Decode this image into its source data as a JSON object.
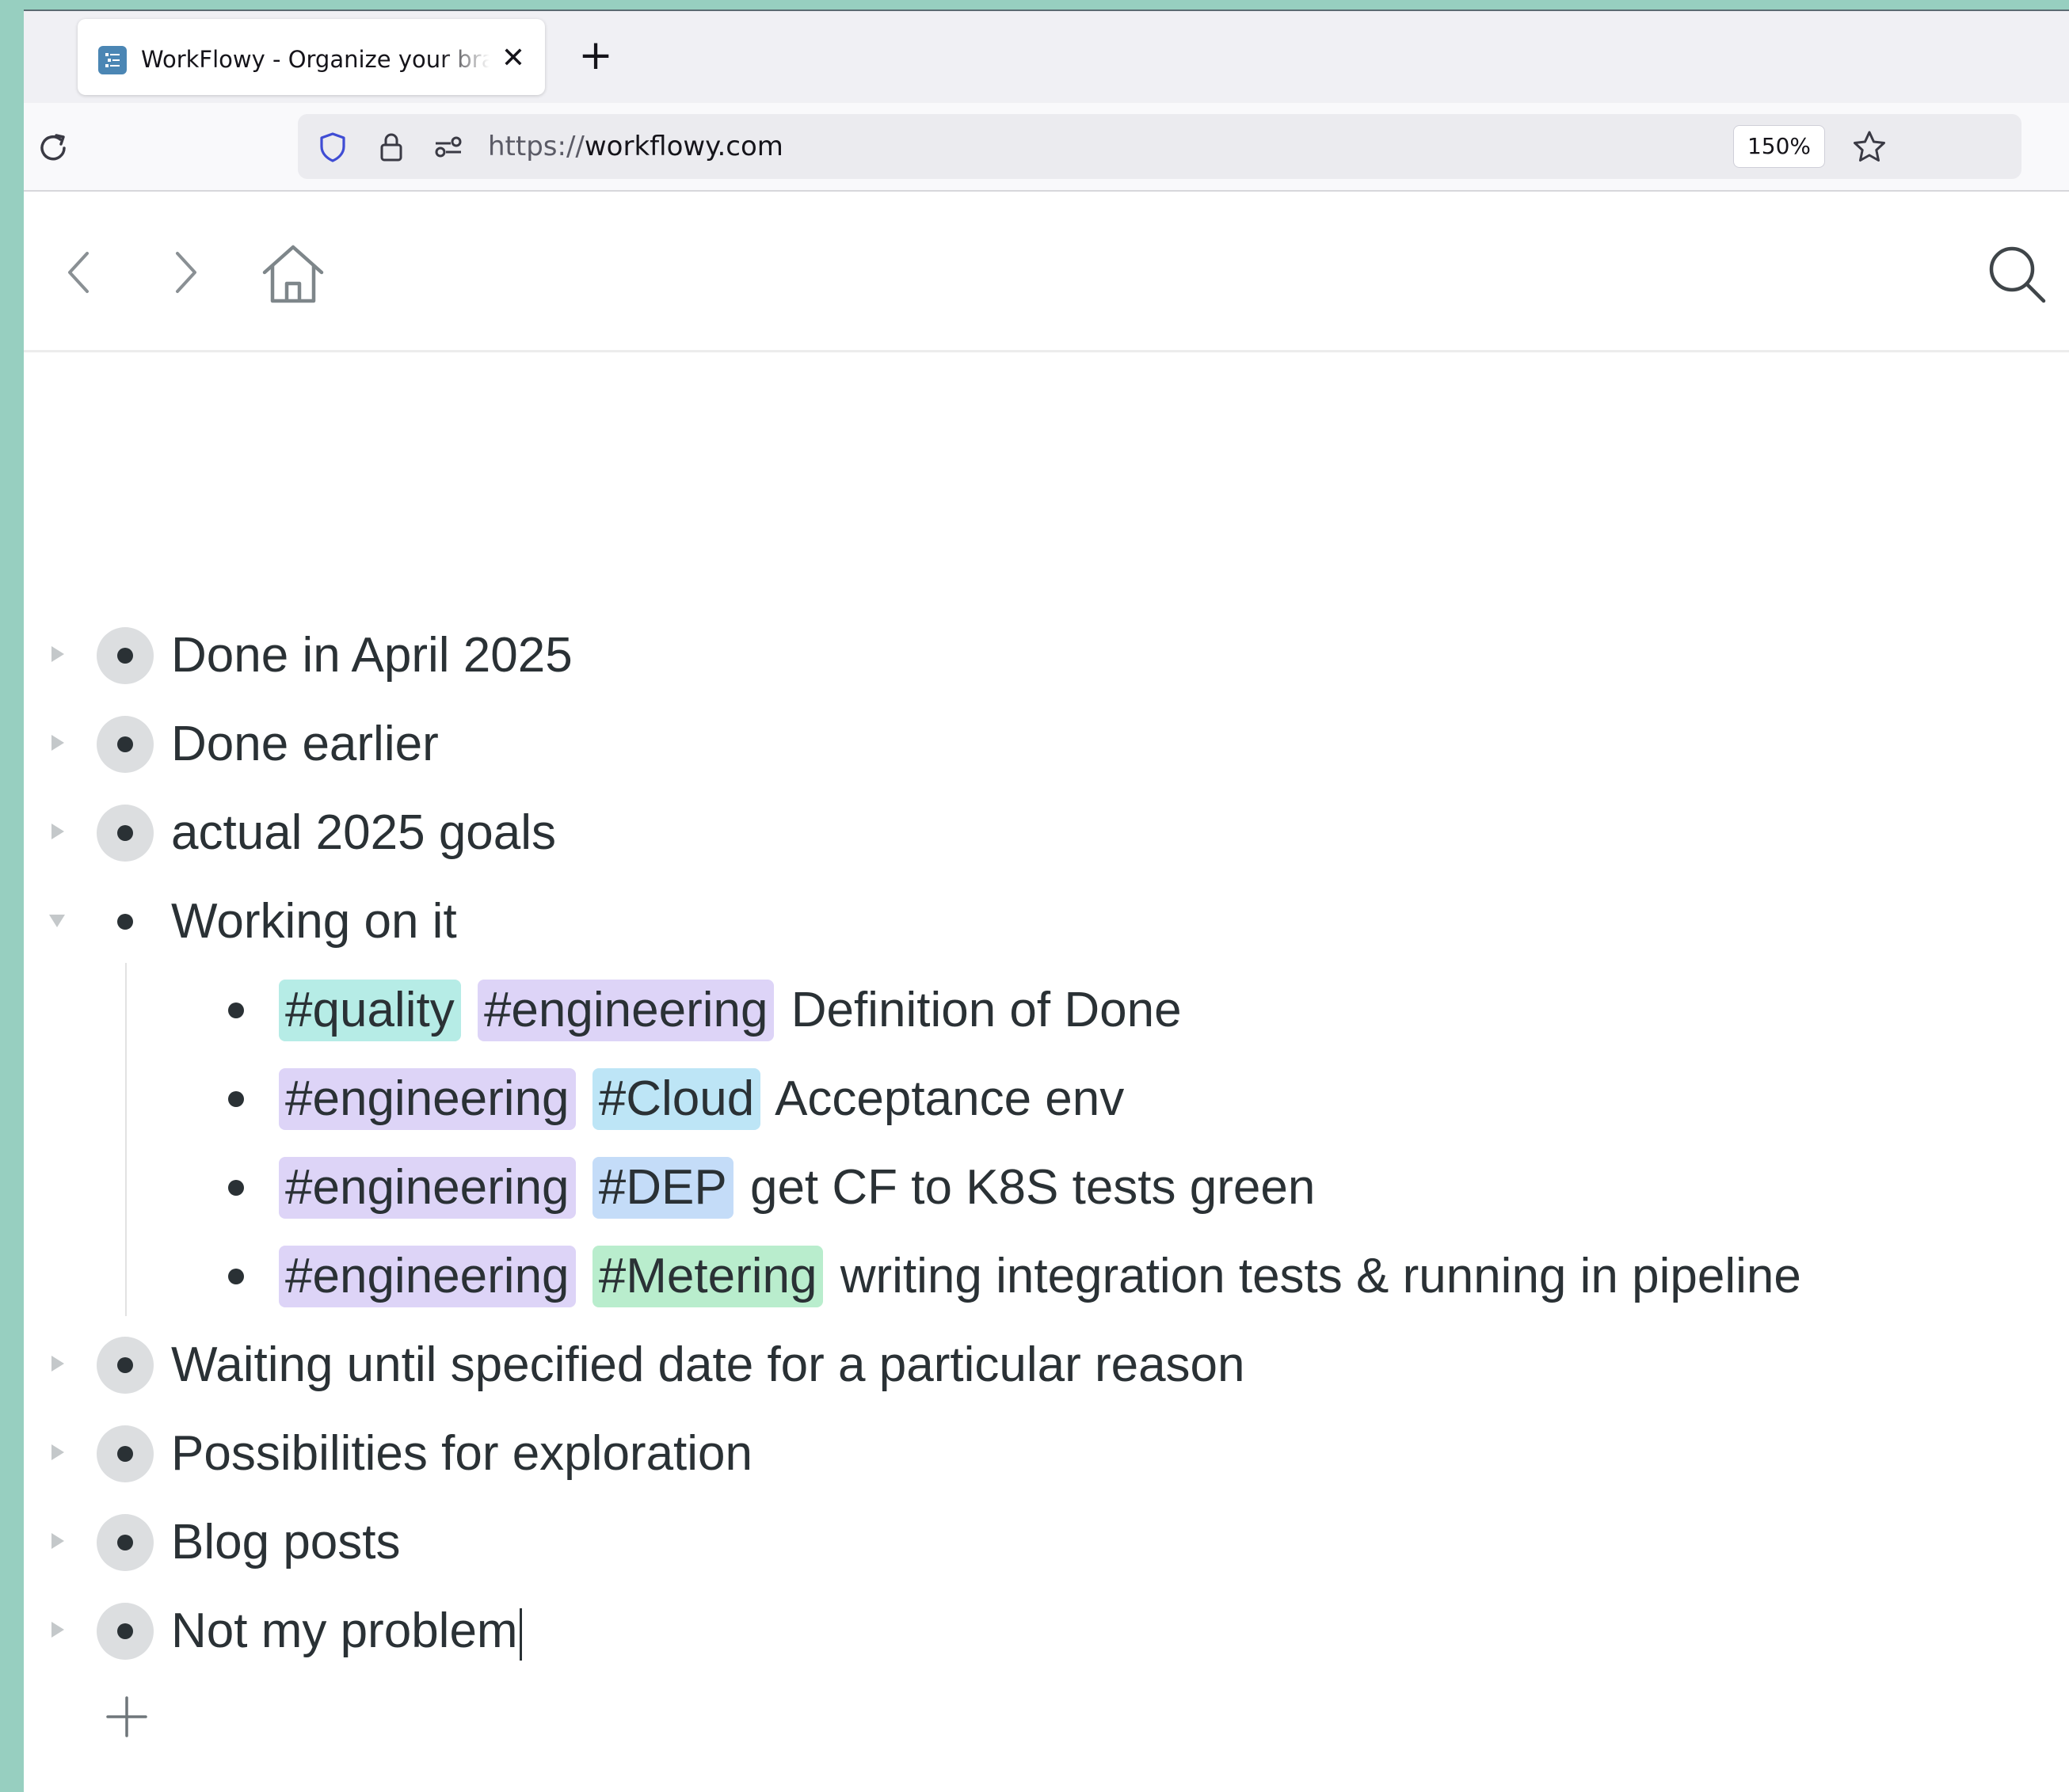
{
  "browser": {
    "tab": {
      "title": "WorkFlowy - Organize your brain",
      "close_glyph": "✕",
      "favicon": "workflowy-list-icon"
    },
    "new_tab_glyph": "+",
    "url_scheme": "https://",
    "url_host": "workflowy.com",
    "zoom": "150%",
    "icons": [
      "reload-icon",
      "shield-icon",
      "lock-icon",
      "permissions-icon",
      "star-icon"
    ]
  },
  "header": {
    "icons": [
      "back-arrow-icon",
      "forward-arrow-icon",
      "home-icon",
      "search-icon"
    ]
  },
  "colors": {
    "tag_quality": "#b6ece6",
    "tag_engineering": "#ddd4f7",
    "tag_cloud": "#bde5f6",
    "tag_dep": "#c4dcf8",
    "tag_metering": "#b9edcd",
    "text": "#2a3135",
    "window_frame": "#97cfc0"
  },
  "outline": {
    "items": [
      {
        "text": "Done in April 2025",
        "collapsed": true
      },
      {
        "text": "Done earlier",
        "collapsed": true
      },
      {
        "text": "actual 2025 goals",
        "collapsed": true
      },
      {
        "text": "Working on it",
        "collapsed": false,
        "children": [
          {
            "tags": [
              "#quality",
              "#engineering"
            ],
            "text": "Definition of Done"
          },
          {
            "tags": [
              "#engineering",
              "#Cloud"
            ],
            "text": "Acceptance env"
          },
          {
            "tags": [
              "#engineering",
              "#DEP"
            ],
            "text": "get CF to K8S tests green"
          },
          {
            "tags": [
              "#engineering",
              "#Metering"
            ],
            "text": "writing integration tests & running in pipeline"
          }
        ]
      },
      {
        "text": "Waiting until specified date for a particular reason",
        "collapsed": true
      },
      {
        "text": "Possibilities for exploration",
        "collapsed": true
      },
      {
        "text": "Blog posts",
        "collapsed": true
      },
      {
        "text": "Not my problem",
        "collapsed": true
      }
    ],
    "add_icon": "plus-icon"
  }
}
